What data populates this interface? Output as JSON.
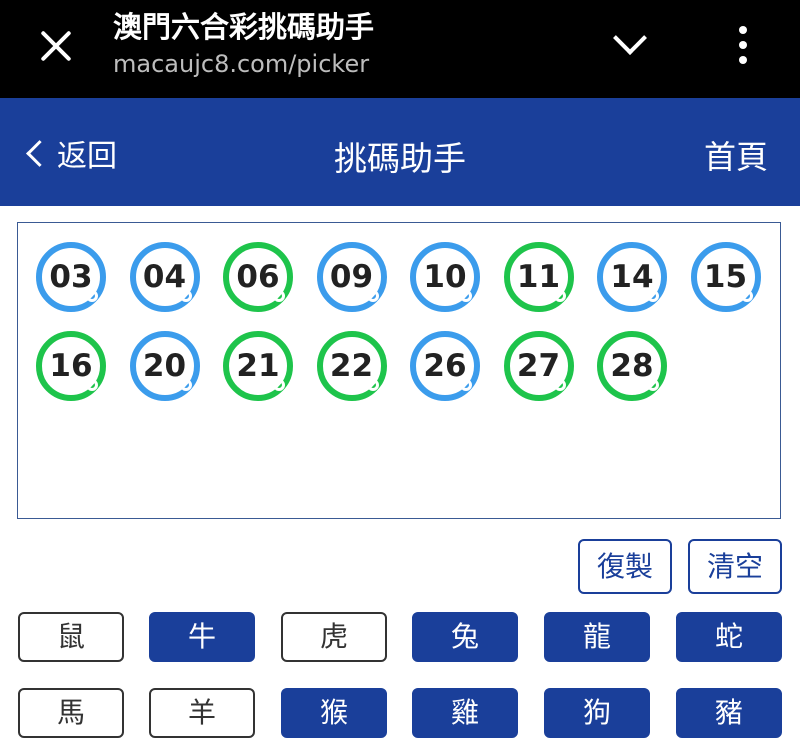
{
  "browser": {
    "title": "澳門六合彩挑碼助手",
    "url": "macaujc8.com/picker",
    "close_icon": "close-icon",
    "expand_icon": "chevron-down-icon",
    "menu_icon": "more-vert-icon"
  },
  "header": {
    "back_label": "返回",
    "title": "挑碼助手",
    "home_label": "首頁",
    "color": "#1a3f9a"
  },
  "numbers": [
    {
      "n": "03",
      "color": "blue"
    },
    {
      "n": "04",
      "color": "blue"
    },
    {
      "n": "06",
      "color": "green"
    },
    {
      "n": "09",
      "color": "blue"
    },
    {
      "n": "10",
      "color": "blue"
    },
    {
      "n": "11",
      "color": "green"
    },
    {
      "n": "14",
      "color": "blue"
    },
    {
      "n": "15",
      "color": "blue"
    },
    {
      "n": "16",
      "color": "green"
    },
    {
      "n": "20",
      "color": "blue"
    },
    {
      "n": "21",
      "color": "green"
    },
    {
      "n": "22",
      "color": "green"
    },
    {
      "n": "26",
      "color": "blue"
    },
    {
      "n": "27",
      "color": "green"
    },
    {
      "n": "28",
      "color": "green"
    }
  ],
  "actions": {
    "copy_label": "復製",
    "clear_label": "清空"
  },
  "zodiac": [
    {
      "label": "鼠",
      "selected": false
    },
    {
      "label": "牛",
      "selected": true
    },
    {
      "label": "虎",
      "selected": false
    },
    {
      "label": "兔",
      "selected": true
    },
    {
      "label": "龍",
      "selected": true
    },
    {
      "label": "蛇",
      "selected": true
    },
    {
      "label": "馬",
      "selected": false
    },
    {
      "label": "羊",
      "selected": false
    },
    {
      "label": "猴",
      "selected": true
    },
    {
      "label": "雞",
      "selected": true
    },
    {
      "label": "狗",
      "selected": true
    },
    {
      "label": "豬",
      "selected": true
    }
  ],
  "colors": {
    "blue_ball": "#3b9cec",
    "green_ball": "#1ec44b",
    "accent": "#1a3f9a"
  }
}
